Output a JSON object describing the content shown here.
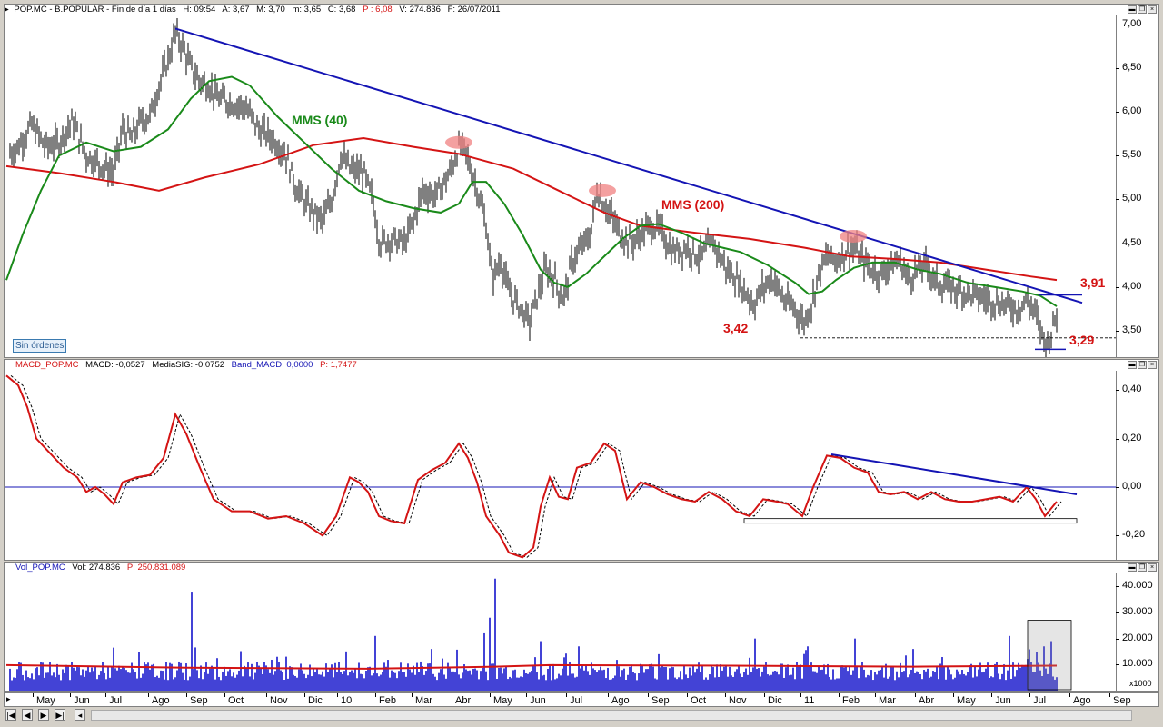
{
  "price_panel": {
    "header": {
      "symbol": "POP.MC - B.POPULAR - Fin de día 1 días",
      "h": "H: 09:54",
      "a": "A: 3,67",
      "m": "M: 3,70",
      "mn": "m: 3,65",
      "c": "C: 3,68",
      "p": "P : 6,08",
      "v": "V: 274.836",
      "f": "F: 26/07/2011"
    },
    "y_ticks": [
      "7,00",
      "6,50",
      "6,00",
      "5,50",
      "5,00",
      "4,50",
      "4,00",
      "3,50"
    ],
    "y_range": [
      3.2,
      7.1
    ],
    "annotations": {
      "mms40": "MMS (40)",
      "mms200": "MMS (200)",
      "low1": "3,42",
      "resistance": "3,91",
      "low2": "3,29"
    },
    "badge": "Sin órdenes",
    "colors": {
      "bars": "#000000",
      "mms40": "#1a8a1a",
      "mms200": "#d41414",
      "trend": "#1414b4",
      "highlight": "#f08080"
    }
  },
  "macd_panel": {
    "header": {
      "name": "MACD_POP.MC",
      "macd": "MACD: -0,0527",
      "sig": "MediaSIG: -0,0752",
      "band": "Band_MACD: 0,0000",
      "p": "P: 1,7477"
    },
    "y_ticks": [
      "0,40",
      "0,20",
      "0,00",
      "-0,20"
    ],
    "y_range": [
      -0.3,
      0.48
    ]
  },
  "volume_panel": {
    "header": {
      "name": "Vol_POP.MC",
      "vol": "Vol: 274.836",
      "p": "P: 250.831.089"
    },
    "y_ticks": [
      "40.000",
      "30.000",
      "20.000",
      "10.000"
    ],
    "y_range": [
      0,
      45000
    ],
    "unit": "x1000"
  },
  "x_axis": {
    "labels": [
      "May",
      "Jun",
      "Jul",
      "Ago",
      "Sep",
      "Oct",
      "Nov",
      "Dic",
      "10",
      "Feb",
      "Mar",
      "Abr",
      "May",
      "Jun",
      "Jul",
      "Ago",
      "Sep",
      "Oct",
      "Nov",
      "Dic",
      "11",
      "Feb",
      "Mar",
      "Abr",
      "May",
      "Jun",
      "Jul",
      "Ago",
      "Sep"
    ]
  },
  "nav": {
    "first": "|◀",
    "prev": "◀",
    "next": "▶",
    "last": "▶|"
  },
  "window_buttons": {
    "min": "▬",
    "restore": "❐",
    "close": "×"
  }
}
